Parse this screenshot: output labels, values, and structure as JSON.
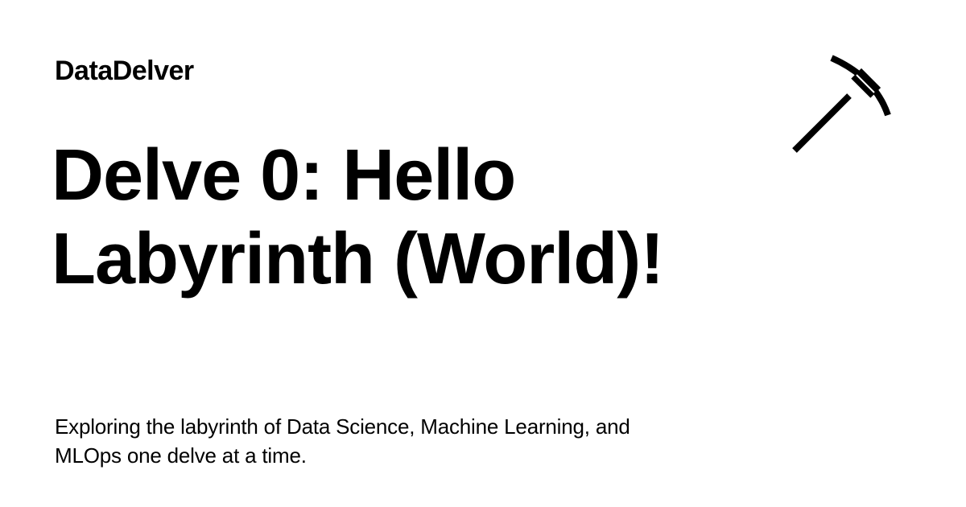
{
  "brand": {
    "name": "DataDelver"
  },
  "post": {
    "title_line1": "Delve 0: Hello",
    "title_line2": "Labyrinth (World)!",
    "description_line1": "Exploring the labyrinth of Data Science, Machine Learning, and",
    "description_line2": "MLOps one delve at a time."
  },
  "icons": {
    "logo": "pickaxe-icon"
  },
  "colors": {
    "background": "#ffffff",
    "text": "#000000"
  }
}
